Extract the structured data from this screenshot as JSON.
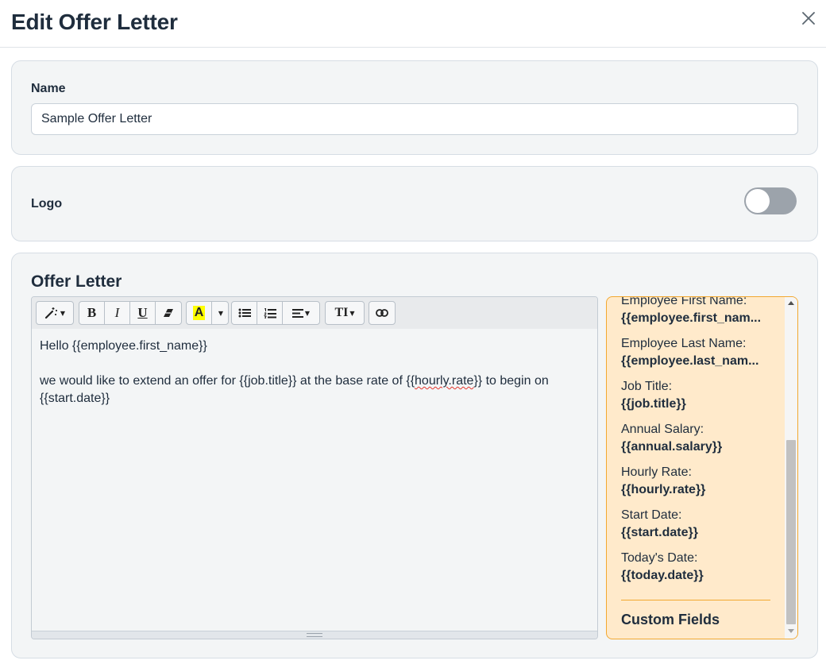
{
  "header": {
    "title": "Edit Offer Letter"
  },
  "name_section": {
    "label": "Name",
    "value": "Sample Offer Letter"
  },
  "logo_section": {
    "label": "Logo",
    "toggle_on": false
  },
  "offer_section": {
    "title": "Offer Letter",
    "toolbar": [
      {
        "icon": "magic-wand-icon",
        "has_dropdown": true
      },
      {
        "icon": "bold-icon",
        "glyph": "B"
      },
      {
        "icon": "italic-icon",
        "glyph": "I"
      },
      {
        "icon": "underline-icon",
        "glyph": "U"
      },
      {
        "icon": "eraser-icon"
      },
      {
        "icon": "highlight-color-icon",
        "glyph": "A",
        "has_dropdown": true
      },
      {
        "icon": "bullet-list-icon"
      },
      {
        "icon": "numbered-list-icon"
      },
      {
        "icon": "align-icon",
        "has_dropdown": true
      },
      {
        "icon": "text-size-icon",
        "glyph": "TI",
        "has_dropdown": true
      },
      {
        "icon": "link-icon"
      }
    ],
    "body": {
      "line1": "Hello {{employee.first_name}}",
      "line2_a": "we would like to extend an offer for {{job.title}} at the base rate of {{",
      "line2_squiggle": "hourly.rate",
      "line2_b": "}} to begin on {{start.date}}"
    },
    "variables": [
      {
        "label": "Employee First Name:",
        "token": "{{employee.first_nam..."
      },
      {
        "label": "Employee Last Name:",
        "token": "{{employee.last_nam..."
      },
      {
        "label": "Job Title:",
        "token": "{{job.title}}"
      },
      {
        "label": "Annual Salary:",
        "token": "{{annual.salary}}"
      },
      {
        "label": "Hourly Rate:",
        "token": "{{hourly.rate}}"
      },
      {
        "label": "Start Date:",
        "token": "{{start.date}}"
      },
      {
        "label": "Today's Date:",
        "token": "{{today.date}}"
      }
    ],
    "custom_fields_label": "Custom Fields"
  },
  "colors": {
    "panel_bg": "#ffeacb",
    "panel_border": "#f2a830",
    "card_bg": "#f3f5f6",
    "toggle_off": "#9ca3ab",
    "highlight_yellow": "#ffff00"
  }
}
